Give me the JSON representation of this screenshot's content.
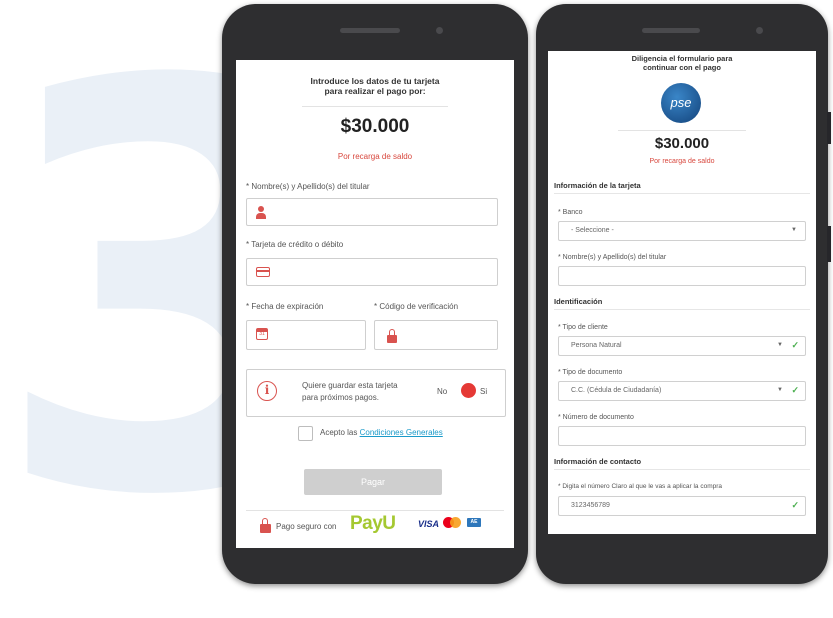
{
  "phone1": {
    "heading_line1": "Introduce los datos de tu tarjeta",
    "heading_line2": "para realizar el pago por:",
    "amount": "$30.000",
    "recharge": "Por recarga de saldo",
    "name_label": "* Nombre(s) y Apellido(s) del titular",
    "card_label": "* Tarjeta de crédito o débito",
    "expiry_label": "* Fecha de expiración",
    "expiry_icon_text": "31",
    "cvv_label": "* Código de verificación",
    "save_card_line1": "Quiere guardar esta tarjeta",
    "save_card_line2": "para próximos pagos.",
    "toggle_no": "No",
    "toggle_si": "Si",
    "terms_prefix": "Acepto las",
    "terms_link": "Condiciones Generales",
    "pay_button": "Pagar",
    "secure_text": "Pago seguro con",
    "payu_logo": "PayU",
    "visa_logo": "VISA",
    "amex_logo": "AE"
  },
  "phone2": {
    "heading_line1": "Diligencia el formulario para",
    "heading_line2": "continuar con el pago",
    "pse_logo": "pse",
    "amount": "$30.000",
    "recharge": "Por recarga de saldo",
    "section_card": "Información de la tarjeta",
    "bank_label": "* Banco",
    "bank_value": "- Seleccione -",
    "holder_label": "* Nombre(s) y Apellido(s) del titular",
    "section_id": "Identificación",
    "client_type_label": "* Tipo de cliente",
    "client_type_value": "Persona Natural",
    "doc_type_label": "* Tipo de documento",
    "doc_type_value": "C.C. (Cédula de Ciudadanía)",
    "doc_number_label": "* Número de documento",
    "section_contact": "Información de contacto",
    "phone_label": "* Digita el número Claro al que le vas a aplicar la compra",
    "phone_value": "3123456789"
  },
  "colors": {
    "accent_red": "#d9534f",
    "toggle_red": "#e53935",
    "link_blue": "#1a9ac9",
    "payu_green": "#a5c831",
    "check_green": "#4caf50",
    "background_three": "#eaf0f7"
  }
}
